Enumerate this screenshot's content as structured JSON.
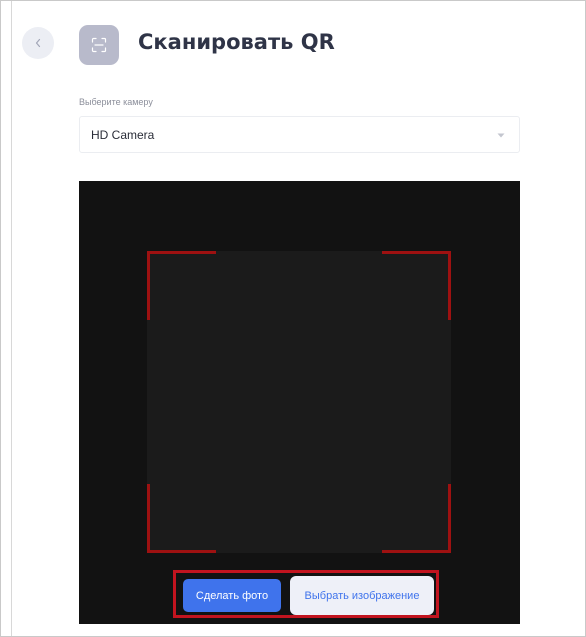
{
  "header": {
    "back_icon": "chevron-left-icon",
    "badge_icon": "qr-scan-icon",
    "title": "Сканировать QR"
  },
  "camera": {
    "label": "Выберите камеру",
    "selected": "HD Camera",
    "arrow_icon": "chevron-down-icon"
  },
  "actions": {
    "take_photo": "Сделать фото",
    "choose_image": "Выбрать изображение"
  },
  "colors": {
    "primary": "#3f73ec",
    "title": "#2f3447",
    "scan_frame": "#9e1111",
    "highlight_frame": "#c2141f",
    "camera_background": "#121212"
  }
}
